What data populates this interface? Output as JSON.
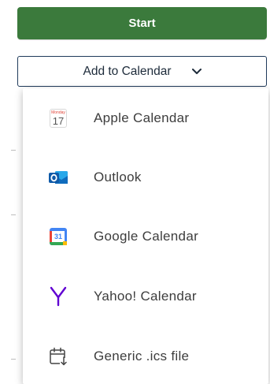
{
  "start_button": {
    "label": "Start"
  },
  "add_to_calendar": {
    "label": "Add to Calendar",
    "icon": "chevron-down-icon"
  },
  "calendar_menu": {
    "items": [
      {
        "label": "Apple Calendar",
        "icon": "apple-calendar-icon",
        "icon_day": "17",
        "icon_month": "Monday"
      },
      {
        "label": "Outlook",
        "icon": "outlook-icon"
      },
      {
        "label": "Google Calendar",
        "icon": "google-calendar-icon",
        "icon_day": "31"
      },
      {
        "label": "Yahoo! Calendar",
        "icon": "yahoo-icon"
      },
      {
        "label": "Generic .ics file",
        "icon": "calendar-download-icon"
      }
    ]
  },
  "colors": {
    "start_green": "#3b7a3c",
    "border_navy": "#1f3a5a",
    "outlook_blue": "#0f6cbd",
    "yahoo_purple": "#6001d2",
    "google_blue": "#4285f4"
  }
}
